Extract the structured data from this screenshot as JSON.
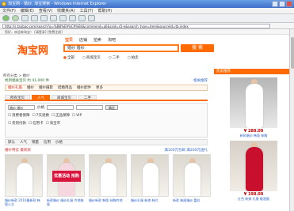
{
  "window": {
    "title": "淘宝网 - 婚纱, 淘宝搜索 - Windows Internet Explorer"
  },
  "menu": [
    "文件(F)",
    "编辑(E)",
    "查看(V)",
    "收藏夹(A)",
    "工具(T)",
    "帮助(H)"
  ],
  "address": {
    "url": "http://s.taobao.com/search?q=%BB%E9%C9%B4&commend=all&ssid=s5-e&search_type=item&sourceId=tb.index"
  },
  "site": {
    "logo": "淘宝网",
    "topnav": "您好，欢迎来淘宝！ [请登录] [免费注册]",
    "search_tabs": [
      "宝贝",
      "店铺",
      "拍卖",
      "淘吧"
    ],
    "query": "婚纱 婚纱",
    "search_button": "搜 索",
    "radios": [
      "全部",
      "商城宝贝",
      "二手",
      "拍卖"
    ]
  },
  "results": {
    "breadcrumb": "所有分类 > 婚纱",
    "info_left": "找到相关宝贝 约 41,000 件",
    "info_right": "相关推荐",
    "categories": [
      "婚纱礼服",
      "婚纱",
      "婚纱摄影",
      "结婚用品",
      "婚纱配件",
      "更多"
    ],
    "tabs": [
      "所有宝贝",
      "人气",
      "商城宝贝",
      "二手"
    ],
    "filter_price_label": "价格",
    "filter_query": "婚纱 婚纱",
    "filter_btn": "确定",
    "filter_options": [
      "消费者保障",
      "7天退换",
      "正品保障",
      "VIP",
      "货到付款",
      "信用卡",
      "淘宝币"
    ],
    "sort_items": [
      "默认",
      "人气",
      "销量",
      "信用",
      "价格"
    ],
    "promo_left": "婚纱特卖 最新款",
    "promo_right": "满100元包邮 满200元送礼",
    "items": [
      {
        "caption": "婚纱新款 2010最新款 韩版公主"
      },
      {
        "caption": "新款婚纱 婚纱礼服 齐地拖尾",
        "ribbon": "优惠活动 抢购"
      },
      {
        "caption": "婚纱新款 韩版 抹胸齐地"
      },
      {
        "caption": "婚纱礼服 新娘 韩式"
      },
      {
        "caption": "新款 拖尾婚纱 蕾丝"
      }
    ]
  },
  "sidebar": {
    "header": "热卖推荐",
    "items": [
      {
        "price": "¥ 288.00",
        "caption": "新款婚纱 韩版 抹胸"
      },
      {
        "price": "¥ 198.00",
        "caption": "红色 新娘 礼服 敬酒服"
      }
    ]
  }
}
